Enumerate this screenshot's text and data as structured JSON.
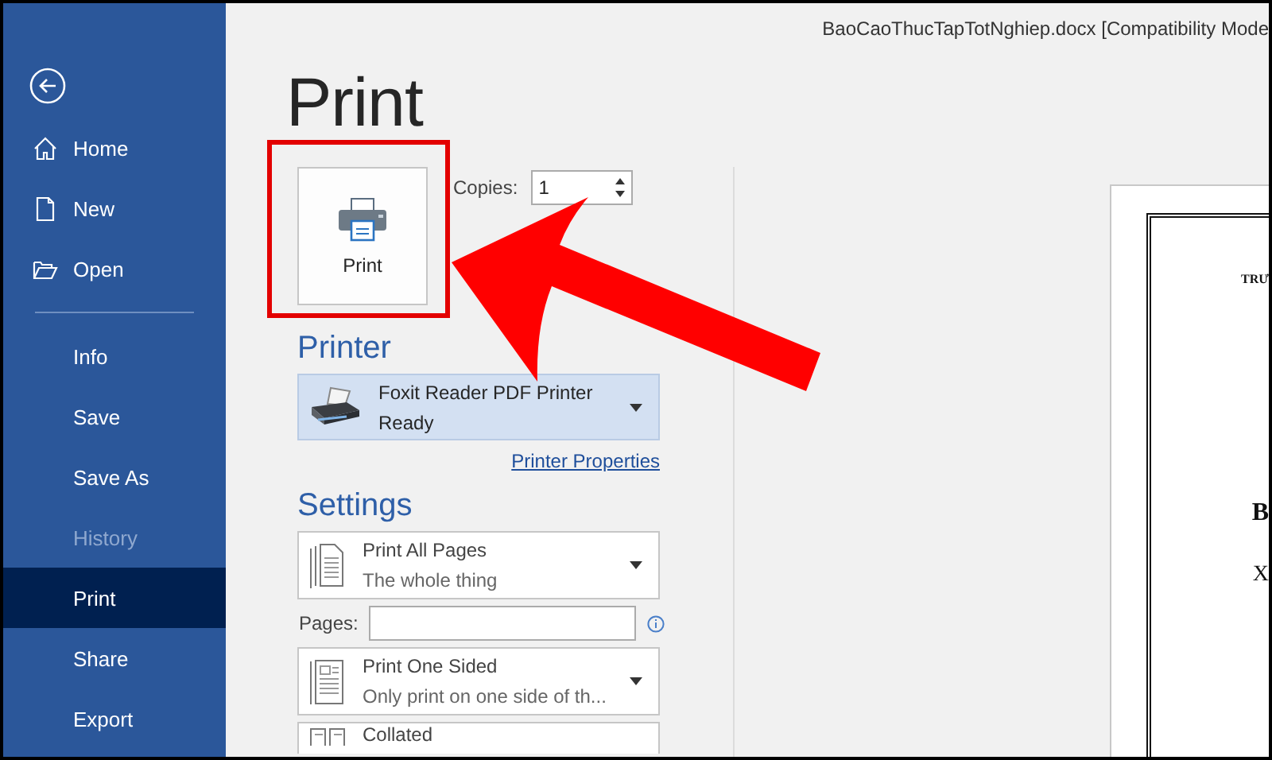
{
  "window": {
    "title": "BaoCaoThucTapTotNghiep.docx [Compatibility Mode"
  },
  "sidebar": {
    "top_items": [
      {
        "label": "Home",
        "selected": false,
        "disabled": false
      },
      {
        "label": "New",
        "selected": false,
        "disabled": false
      },
      {
        "label": "Open",
        "selected": false,
        "disabled": false
      }
    ],
    "items": [
      {
        "label": "Info",
        "selected": false,
        "disabled": false
      },
      {
        "label": "Save",
        "selected": false,
        "disabled": false
      },
      {
        "label": "Save As",
        "selected": false,
        "disabled": false
      },
      {
        "label": "History",
        "selected": false,
        "disabled": true
      },
      {
        "label": "Print",
        "selected": true,
        "disabled": false
      },
      {
        "label": "Share",
        "selected": false,
        "disabled": false
      },
      {
        "label": "Export",
        "selected": false,
        "disabled": false
      }
    ]
  },
  "print": {
    "heading": "Print",
    "print_button": "Print",
    "copies": {
      "label": "Copies:",
      "value": "1"
    },
    "printer": {
      "heading": "Printer",
      "name": "Foxit Reader PDF Printer",
      "status": "Ready",
      "properties_link": "Printer Properties"
    },
    "settings": {
      "heading": "Settings",
      "rows": [
        {
          "kind": "dropdown",
          "title": "Print All Pages",
          "subtitle": "The whole thing"
        },
        {
          "kind": "field",
          "label": "Pages:"
        },
        {
          "kind": "dropdown",
          "title": "Print One Sided",
          "subtitle": "Only print on one side of th..."
        },
        {
          "kind": "dropdown",
          "title": "Collated"
        }
      ]
    }
  },
  "preview": {
    "lines": [
      {
        "kind": "small",
        "text": "TRƯ"
      },
      {
        "kind": "heading",
        "text": "B"
      },
      {
        "kind": "body",
        "text": "X"
      }
    ]
  }
}
